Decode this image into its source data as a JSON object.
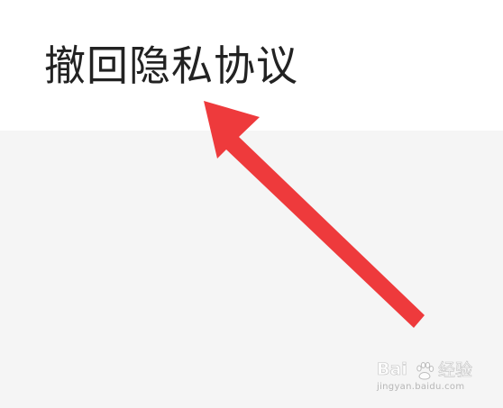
{
  "menu": {
    "revoke_privacy_label": "撤回隐私协议"
  },
  "annotation": {
    "arrow_color": "#ee3a3c"
  },
  "watermark": {
    "logo_text": "Bai",
    "logo_suffix": "经验",
    "url": "jingyan.baidu.com"
  },
  "colors": {
    "item_background": "#ffffff",
    "page_background": "#f5f5f5",
    "label_text": "#222222"
  }
}
